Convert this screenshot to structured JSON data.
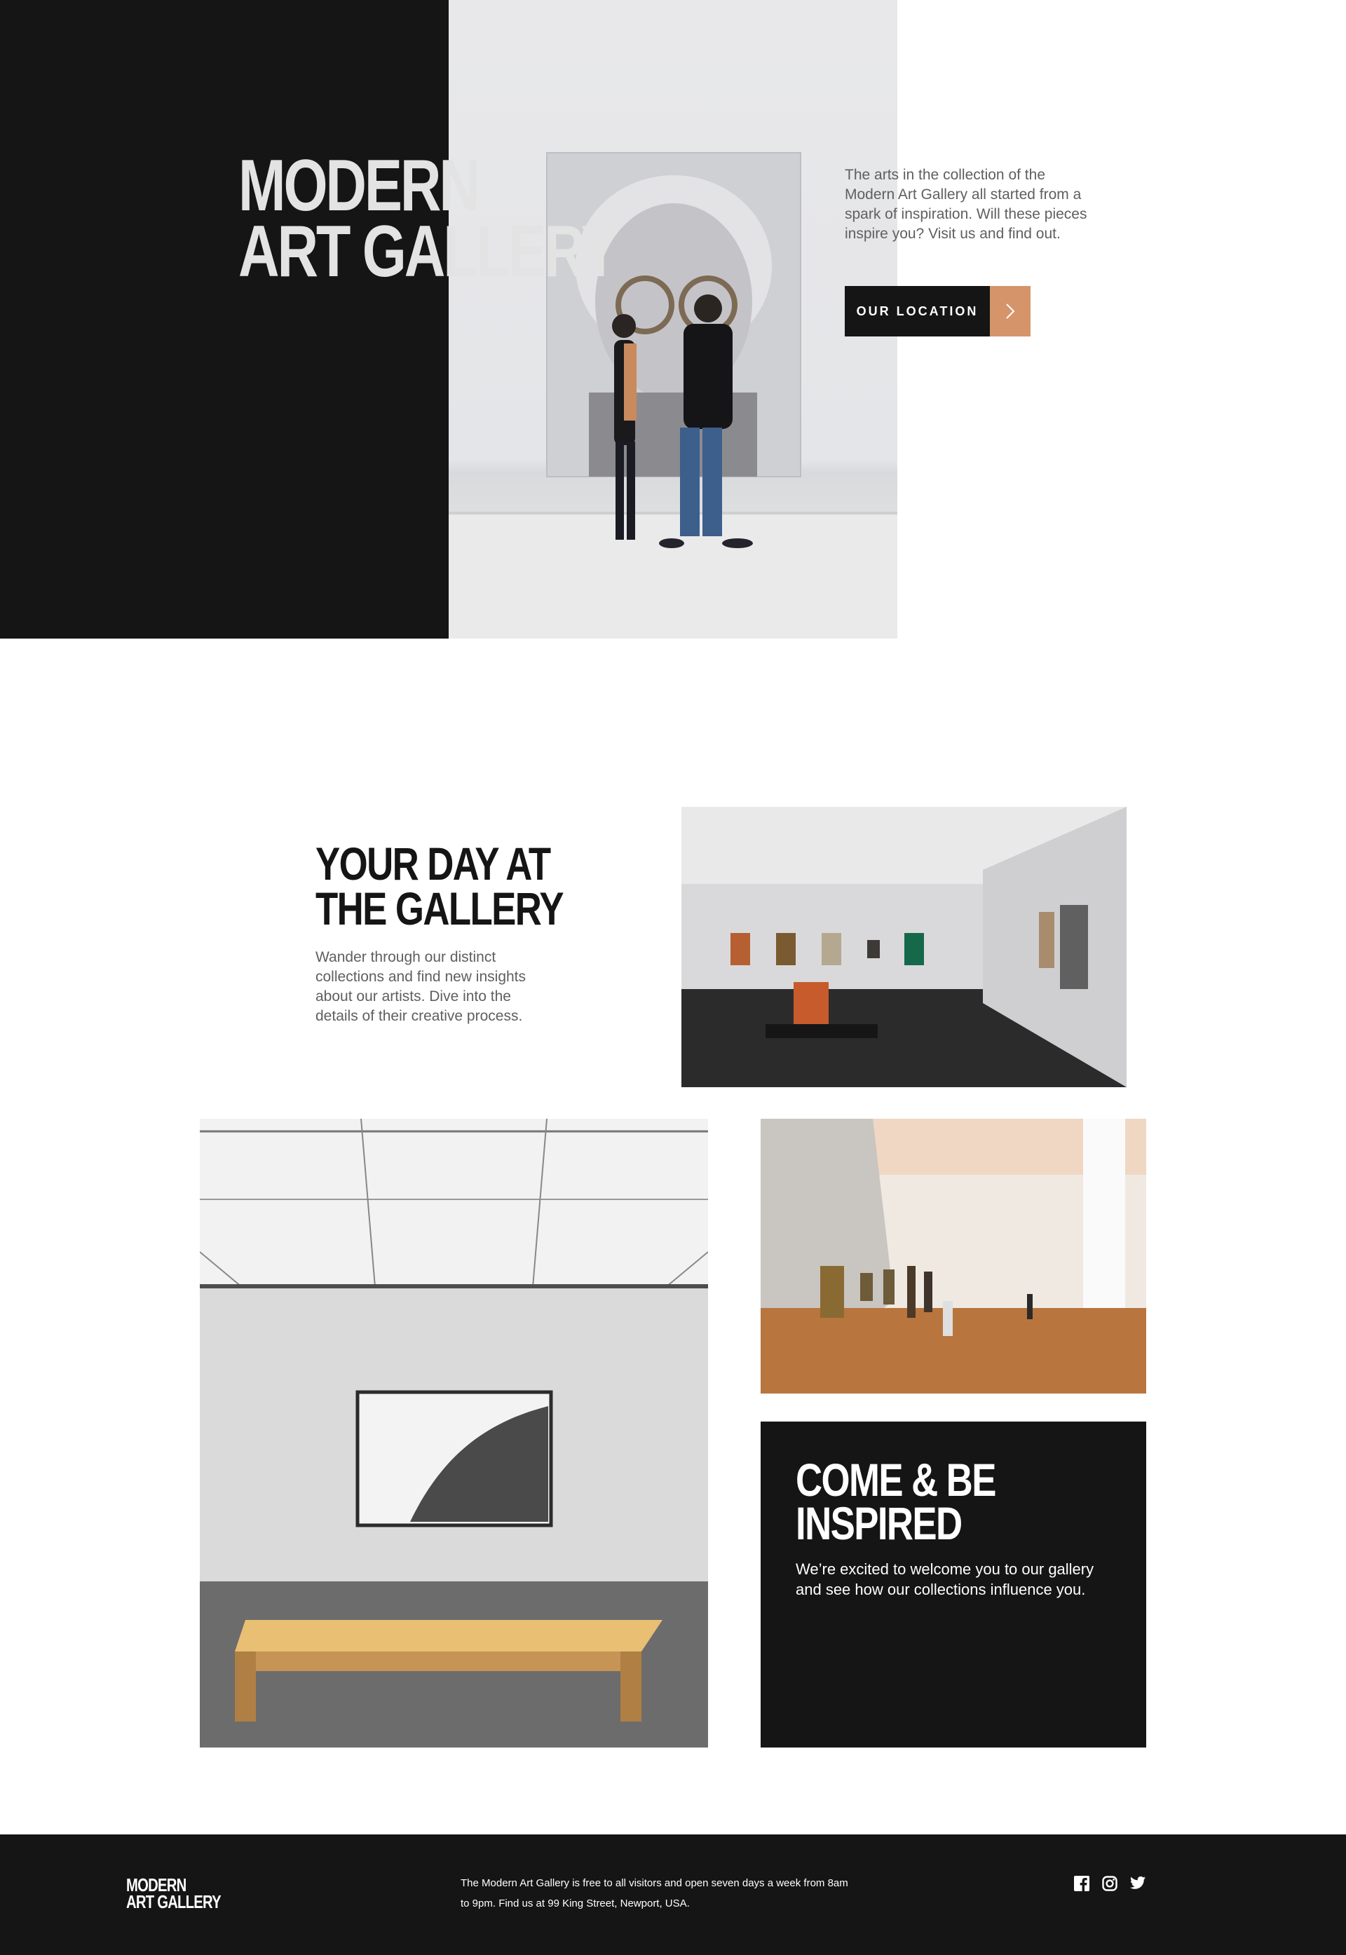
{
  "hero": {
    "title_line1": "MODERN",
    "title_line2": "ART GALLERY",
    "intro": "The arts in the collection of the Modern Art Gallery all started from a spark of inspiration. Will these pieces inspire you? Visit us and find out.",
    "button_label": "OUR LOCATION",
    "button_icon": "chevron-right-icon"
  },
  "day": {
    "title_line1": "YOUR DAY AT",
    "title_line2": "THE GALLERY",
    "text": "Wander through our distinct collections and find new insights about our artists. Dive into the details of their creative process."
  },
  "inspire": {
    "title_line1": "COME & BE",
    "title_line2": "INSPIRED",
    "text": "We’re excited to welcome you to our gallery and see how our collections influence you."
  },
  "footer": {
    "logo_line1": "MODERN",
    "logo_line2": "ART GALLERY",
    "text": "The Modern Art Gallery is free to all visitors and open seven days a week from 8am to 9pm. Find us at 99 King Street, Newport, USA.",
    "social": [
      "facebook-icon",
      "instagram-icon",
      "twitter-icon"
    ]
  },
  "colors": {
    "dark": "#151515",
    "accent": "#d5946a",
    "body_text": "#5f5f5f",
    "white": "#ffffff"
  }
}
